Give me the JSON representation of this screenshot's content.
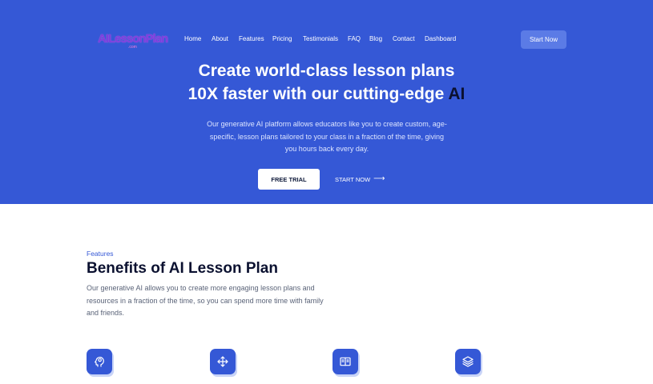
{
  "brand": {
    "logo_text": "AILessonPlan",
    "logo_sub": ".com"
  },
  "nav": {
    "items": [
      {
        "label": "Home"
      },
      {
        "label": "About"
      },
      {
        "label": "Features"
      },
      {
        "label": "Pricing"
      },
      {
        "label": "Testimonials"
      },
      {
        "label": "FAQ"
      },
      {
        "label": "Blog"
      },
      {
        "label": "Contact"
      },
      {
        "label": "Dashboard"
      }
    ],
    "cta_label": "Start Now"
  },
  "hero": {
    "title_line1": "Create world-class lesson plans",
    "title_line2_prefix": "10X faster with our cutting-edge",
    "title_line2_highlight": "AI",
    "description": "Our generative AI platform allows educators like you to create custom, age-specific, lesson plans tailored to your class in a fraction of the time, giving you hours back every day.",
    "primary_button": "FREE TRIAL",
    "secondary_link": "START NOW",
    "secondary_arrow": "⟶"
  },
  "features": {
    "eyebrow": "Features",
    "title": "Benefits of AI Lesson Plan",
    "description": "Our generative AI allows you to create more engaging lesson plans and resources in a fraction of the time, so you can spend more time with family and friends.",
    "icons": [
      "head-idea-icon",
      "move-arrows-icon",
      "open-book-icon",
      "layers-icon"
    ]
  },
  "colors": {
    "hero_bg": "#3558d6",
    "accent": "#3558d6",
    "dark_text": "#0b1130",
    "muted_text": "#5a6378"
  }
}
